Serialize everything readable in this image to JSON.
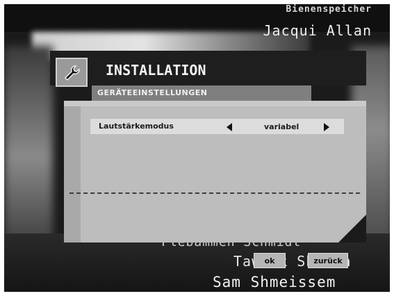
{
  "video_credits": {
    "top_small": "Bienenspeicher",
    "top_name": "Jacqui Allan",
    "bottom_1": "Flebammen Schmidt",
    "bottom_2": "Tawfik Sheikh",
    "bottom_3": "Sam Shmeissem"
  },
  "dialog": {
    "title": "INSTALLATION",
    "subtitle": "GERÄTEEINSTELLUNGEN",
    "icon": "wrench-icon",
    "setting": {
      "label": "Lautstärkemodus",
      "value": "variabel"
    }
  },
  "buttons": {
    "ok": "ok",
    "back": "zurück"
  },
  "colors": {
    "header": "#1e1e1e",
    "subhead": "#7f7f7f",
    "panel": "#bdbdbd",
    "row": "#dcdcdc"
  }
}
